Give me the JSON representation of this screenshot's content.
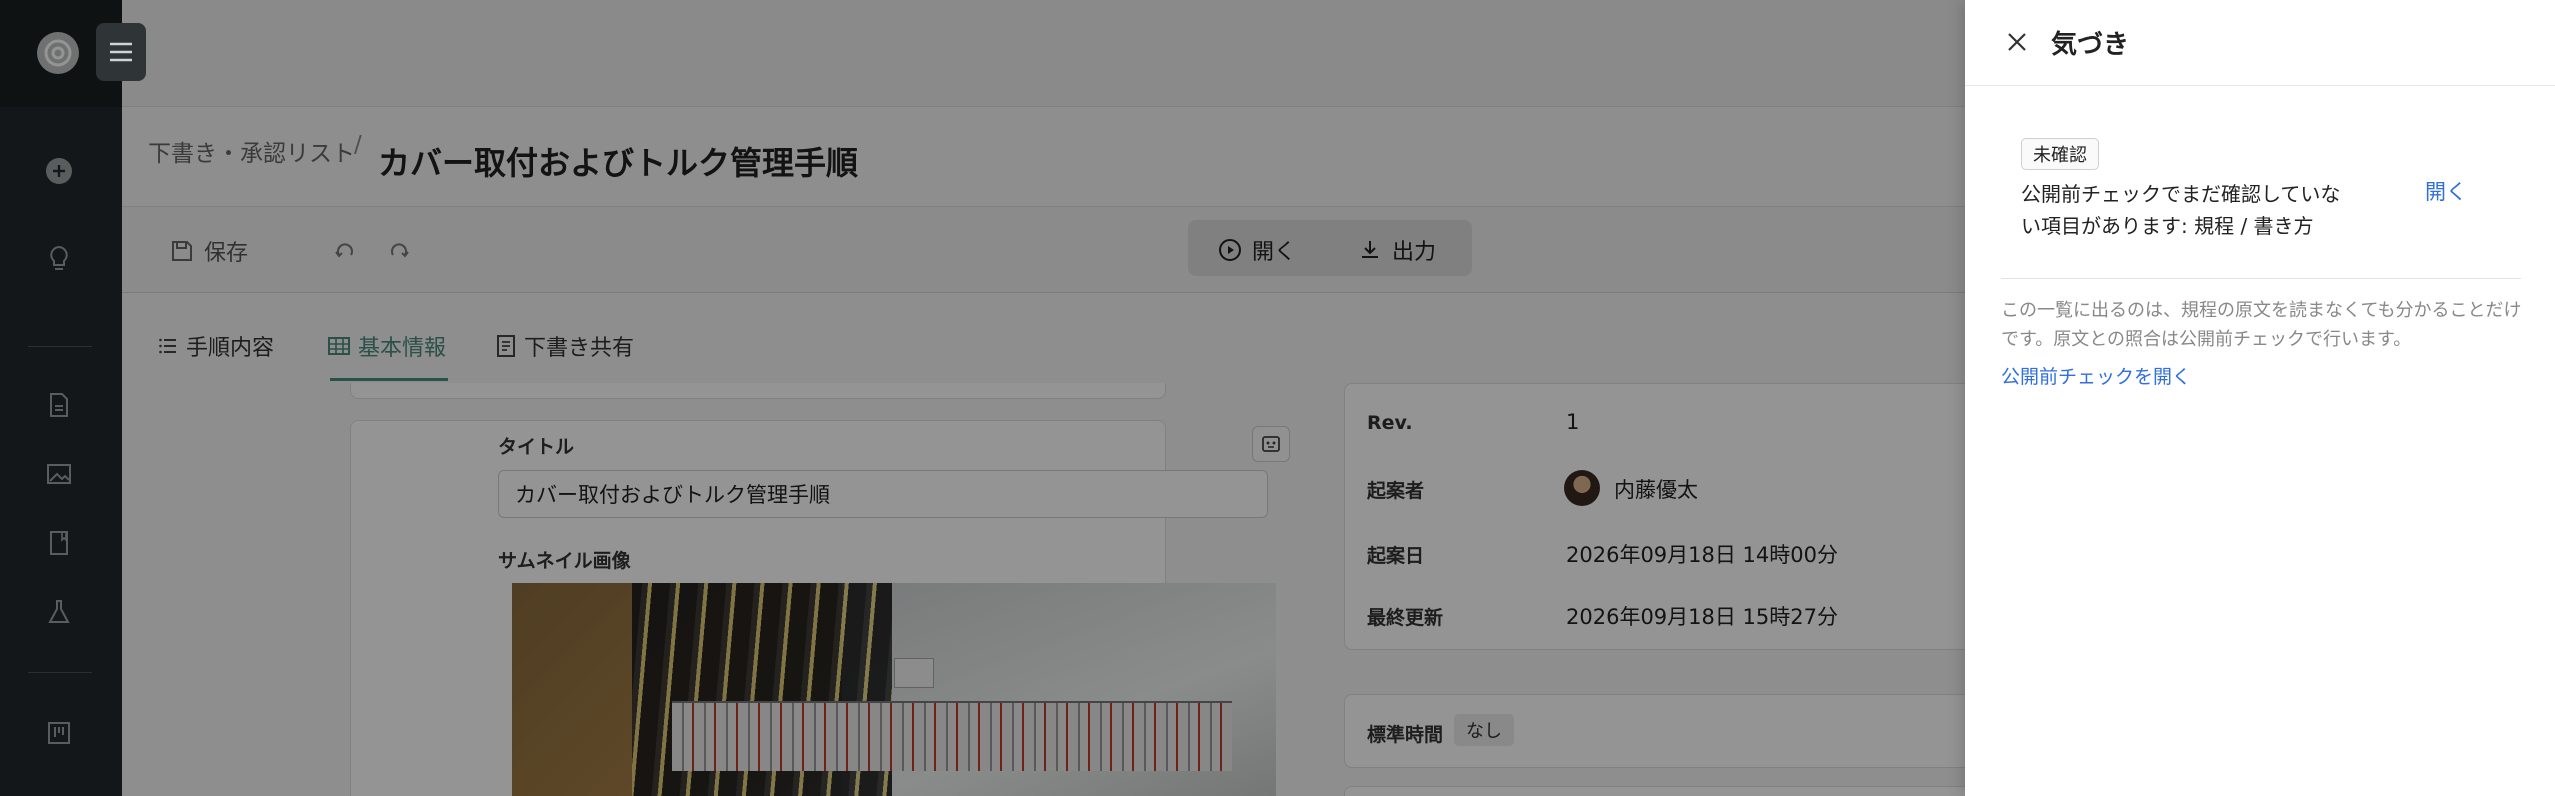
{
  "header": {
    "breadcrumb": "下書き・承認リスト",
    "breadcrumb_separator": "/",
    "title": "カバー取付およびトルク管理手順"
  },
  "toolbar": {
    "save_label": "保存",
    "open_label": "開く",
    "export_label": "出力"
  },
  "tabs": [
    {
      "label": "手順内容",
      "icon": "list-icon"
    },
    {
      "label": "基本情報",
      "icon": "table-icon",
      "active": true
    },
    {
      "label": "下書き共有",
      "icon": "document-share-icon"
    }
  ],
  "form": {
    "title_label": "タイトル",
    "title_value": "カバー取付およびトルク管理手順",
    "thumbnail_label": "サムネイル画像"
  },
  "info": {
    "rev_label": "Rev.",
    "rev_value": "1",
    "author_label": "起案者",
    "author_value": "内藤優太",
    "created_label": "起案日",
    "created_value": "2026年09月18日 14時00分",
    "updated_label": "最終更新",
    "updated_value": "2026年09月18日 15時27分",
    "std_time_label": "標準時間",
    "std_time_value": "なし"
  },
  "drawer": {
    "title": "気づき",
    "item": {
      "status": "未確認",
      "text": "公開前チェックでまだ確認していない項目があります: 規程 / 書き方",
      "open_label": "開く"
    },
    "note": "この一覧に出るのは、規程の原文を読まなくても分かることだけです。原文との照合は公開前チェックで行います。",
    "link": "公開前チェックを開く"
  },
  "colors": {
    "accent": "#4a8a7a",
    "link": "#2f6fde",
    "sidebar": "#23292b"
  }
}
